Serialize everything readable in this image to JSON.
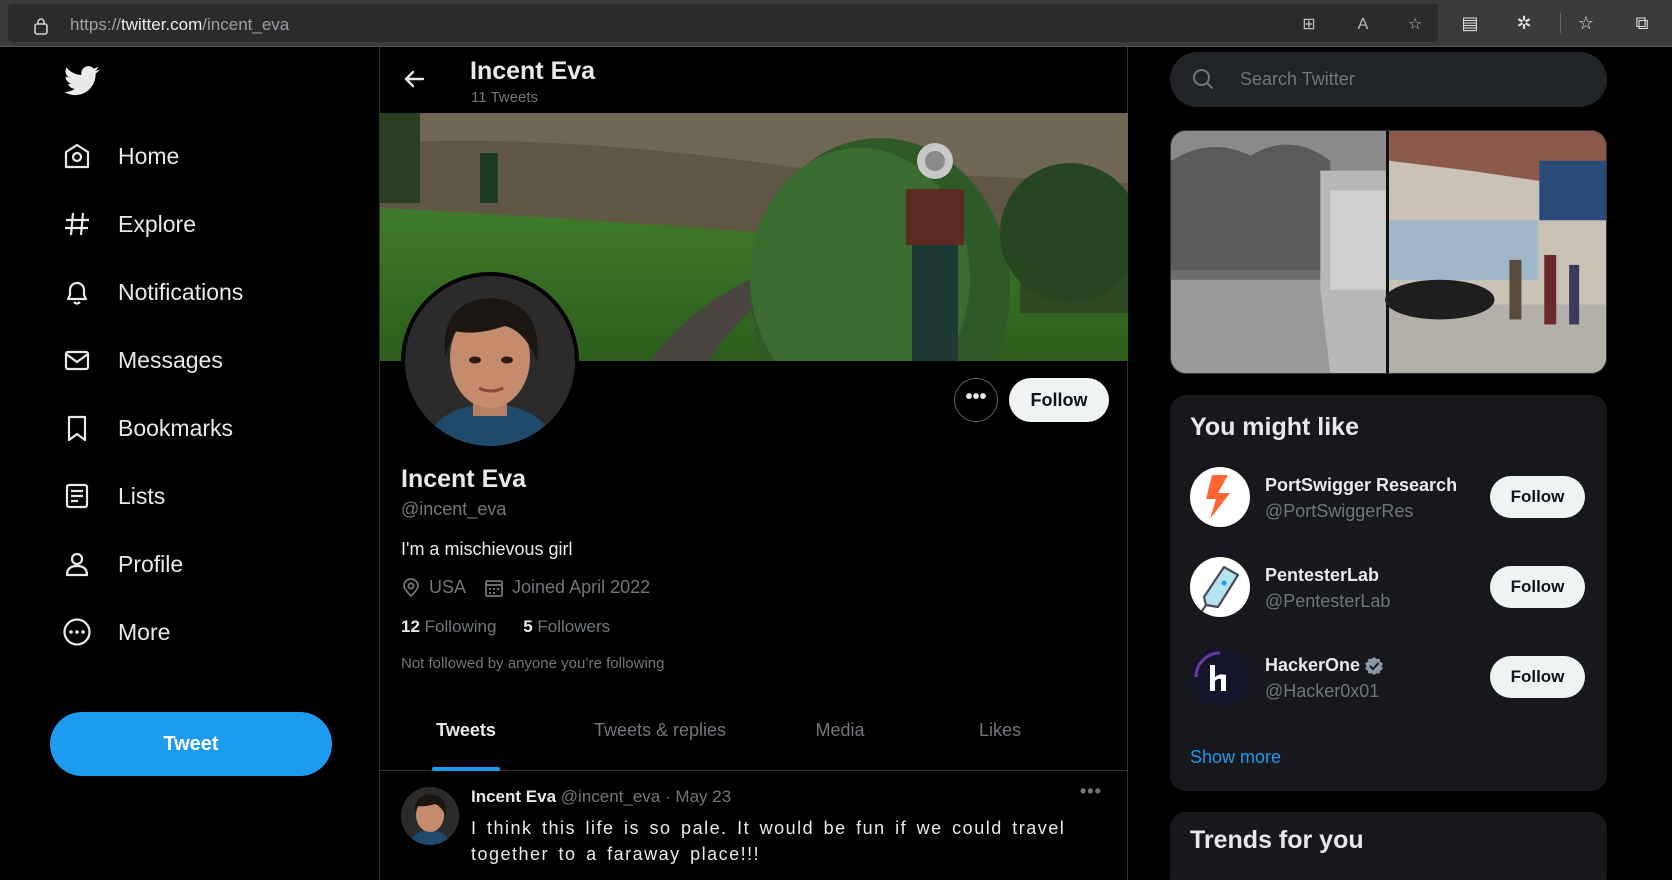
{
  "browser": {
    "url_scheme": "https://",
    "url_host": "twitter.com",
    "url_path": "/incent_eva"
  },
  "nav": {
    "items": [
      {
        "label": "Home",
        "icon": "home-icon"
      },
      {
        "label": "Explore",
        "icon": "hashtag-icon"
      },
      {
        "label": "Notifications",
        "icon": "bell-icon"
      },
      {
        "label": "Messages",
        "icon": "envelope-icon"
      },
      {
        "label": "Bookmarks",
        "icon": "bookmark-icon"
      },
      {
        "label": "Lists",
        "icon": "list-icon"
      },
      {
        "label": "Profile",
        "icon": "person-icon"
      },
      {
        "label": "More",
        "icon": "more-circle-icon"
      }
    ],
    "tweet_button": "Tweet"
  },
  "header": {
    "name": "Incent Eva",
    "tweet_count": "11 Tweets"
  },
  "profile": {
    "more_button": "•••",
    "follow_button": "Follow",
    "name": "Incent Eva",
    "handle": "@incent_eva",
    "bio": "I'm a mischievous girl",
    "location": "USA",
    "joined": "Joined April 2022",
    "following_count": "12",
    "following_label": "Following",
    "followers_count": "5",
    "followers_label": "Followers",
    "note": "Not followed by anyone you’re following"
  },
  "tabs": [
    {
      "label": "Tweets",
      "active": true
    },
    {
      "label": "Tweets & replies",
      "active": false
    },
    {
      "label": "Media",
      "active": false
    },
    {
      "label": "Likes",
      "active": false
    }
  ],
  "tweet": {
    "name": "Incent Eva",
    "handle": "@incent_eva",
    "separator": "·",
    "date": "May 23",
    "more": "•••",
    "text": "I think this life is so pale. It would be fun if we could travel together to a faraway place!!!"
  },
  "search": {
    "placeholder": "Search Twitter"
  },
  "who_to_follow": {
    "title": "You might like",
    "suggestions": [
      {
        "name": "PortSwigger Research",
        "handle": "@PortSwiggerRes",
        "follow": "Follow",
        "verified": false
      },
      {
        "name": "PentesterLab",
        "handle": "@PentesterLab",
        "follow": "Follow",
        "verified": false
      },
      {
        "name": "HackerOne",
        "handle": "@Hacker0x01",
        "follow": "Follow",
        "verified": true
      }
    ],
    "show_more": "Show more"
  },
  "trends": {
    "title": "Trends for you"
  },
  "colors": {
    "accent": "#1d9bf0",
    "background": "#000000",
    "panel": "#16181c",
    "muted_text": "#71767b"
  }
}
